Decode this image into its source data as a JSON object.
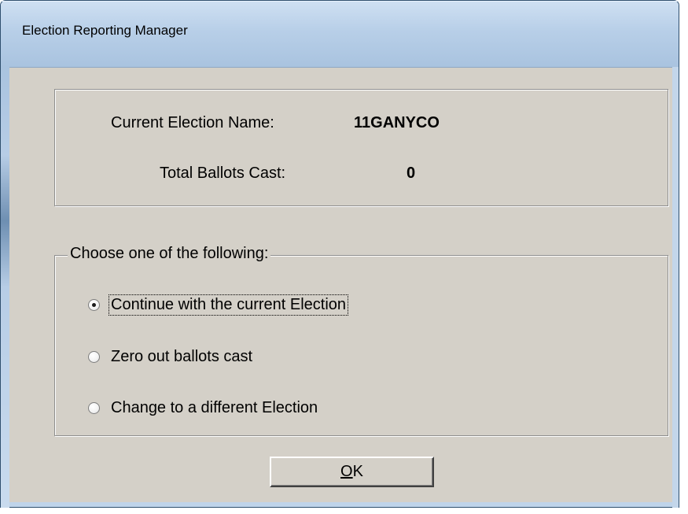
{
  "window": {
    "title": "Election Reporting Manager"
  },
  "info": {
    "election_name_label": "Current Election Name:",
    "election_name_value": "11GANYCO",
    "ballots_label": "Total Ballots Cast:",
    "ballots_value": "0"
  },
  "choices": {
    "legend": "Choose one of the following:",
    "options": [
      {
        "label": "Continue with the current Election",
        "checked": true,
        "focused": true
      },
      {
        "label": "Zero out ballots cast",
        "checked": false,
        "focused": false
      },
      {
        "label": "Change to a different Election",
        "checked": false,
        "focused": false
      }
    ]
  },
  "buttons": {
    "ok_mnemonic": "O",
    "ok_rest": "K"
  },
  "colors": {
    "titlebar": "#b8cfe8",
    "dialog_face": "#d4d0c8"
  }
}
